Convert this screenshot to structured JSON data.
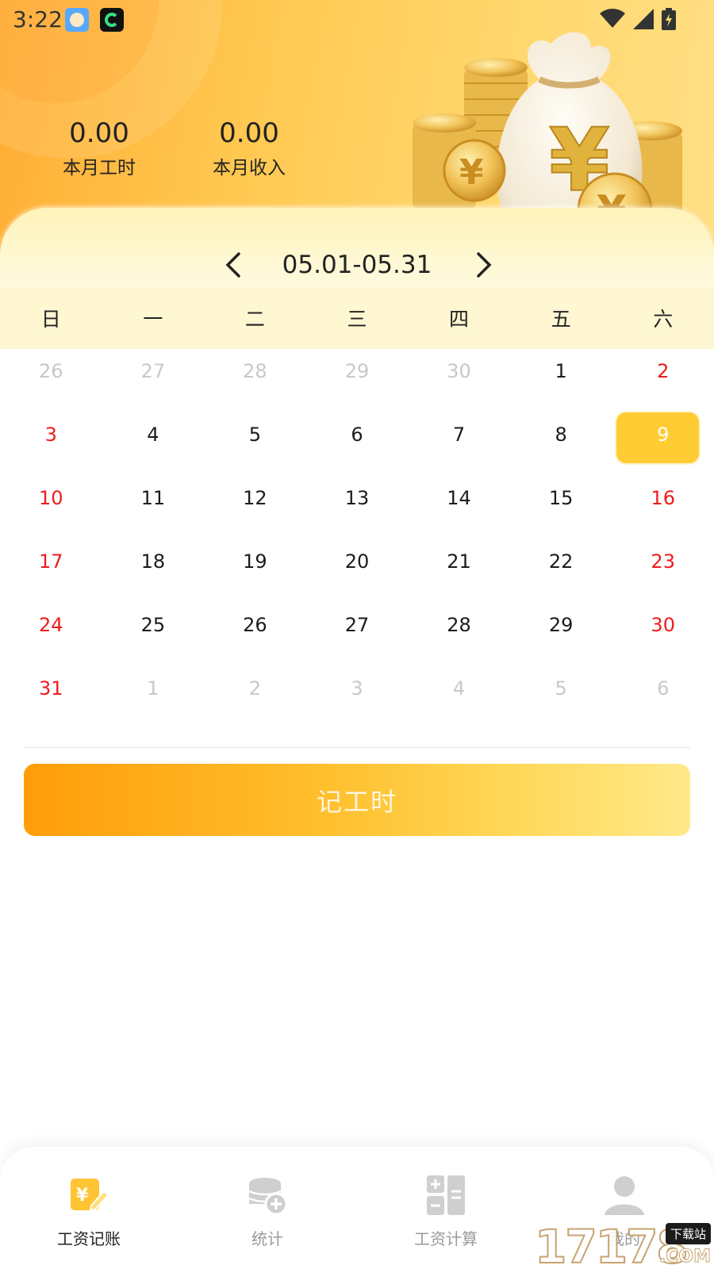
{
  "status_bar": {
    "time": "3:22"
  },
  "summary": {
    "hours_value": "0.00",
    "hours_label": "本月工时",
    "income_value": "0.00",
    "income_label": "本月收入"
  },
  "range": {
    "label": "05.01-05.31"
  },
  "weekdays": [
    "日",
    "一",
    "二",
    "三",
    "四",
    "五",
    "六"
  ],
  "calendar": {
    "days": [
      {
        "n": "26",
        "type": "other"
      },
      {
        "n": "27",
        "type": "other"
      },
      {
        "n": "28",
        "type": "other"
      },
      {
        "n": "29",
        "type": "other"
      },
      {
        "n": "30",
        "type": "other"
      },
      {
        "n": "1",
        "type": "normal"
      },
      {
        "n": "2",
        "type": "weekend"
      },
      {
        "n": "3",
        "type": "weekend"
      },
      {
        "n": "4",
        "type": "normal"
      },
      {
        "n": "5",
        "type": "normal"
      },
      {
        "n": "6",
        "type": "normal"
      },
      {
        "n": "7",
        "type": "normal"
      },
      {
        "n": "8",
        "type": "normal"
      },
      {
        "n": "9",
        "type": "selected"
      },
      {
        "n": "10",
        "type": "weekend"
      },
      {
        "n": "11",
        "type": "normal"
      },
      {
        "n": "12",
        "type": "normal"
      },
      {
        "n": "13",
        "type": "normal"
      },
      {
        "n": "14",
        "type": "normal"
      },
      {
        "n": "15",
        "type": "normal"
      },
      {
        "n": "16",
        "type": "weekend"
      },
      {
        "n": "17",
        "type": "weekend"
      },
      {
        "n": "18",
        "type": "normal"
      },
      {
        "n": "19",
        "type": "normal"
      },
      {
        "n": "20",
        "type": "normal"
      },
      {
        "n": "21",
        "type": "normal"
      },
      {
        "n": "22",
        "type": "normal"
      },
      {
        "n": "23",
        "type": "weekend"
      },
      {
        "n": "24",
        "type": "weekend"
      },
      {
        "n": "25",
        "type": "normal"
      },
      {
        "n": "26",
        "type": "normal"
      },
      {
        "n": "27",
        "type": "normal"
      },
      {
        "n": "28",
        "type": "normal"
      },
      {
        "n": "29",
        "type": "normal"
      },
      {
        "n": "30",
        "type": "weekend"
      },
      {
        "n": "31",
        "type": "weekend"
      },
      {
        "n": "1",
        "type": "other"
      },
      {
        "n": "2",
        "type": "other"
      },
      {
        "n": "3",
        "type": "other"
      },
      {
        "n": "4",
        "type": "other"
      },
      {
        "n": "5",
        "type": "other"
      },
      {
        "n": "6",
        "type": "other"
      }
    ]
  },
  "record_button": {
    "label": "记工时"
  },
  "nav": {
    "items": [
      {
        "label": "工资记账",
        "icon": "wage-record-icon",
        "active": true
      },
      {
        "label": "统计",
        "icon": "statistics-icon",
        "active": false
      },
      {
        "label": "工资计算",
        "icon": "calculator-icon",
        "active": false
      },
      {
        "label": "我的",
        "icon": "profile-icon",
        "active": false
      }
    ]
  },
  "watermark": {
    "digits": "17178",
    "tag": "下载站",
    "suffix": ".COM"
  },
  "colors": {
    "accent": "#ffcc33",
    "weekend": "#ee1c1c",
    "button_start": "#ff9d0a",
    "button_end": "#ffe98a"
  }
}
